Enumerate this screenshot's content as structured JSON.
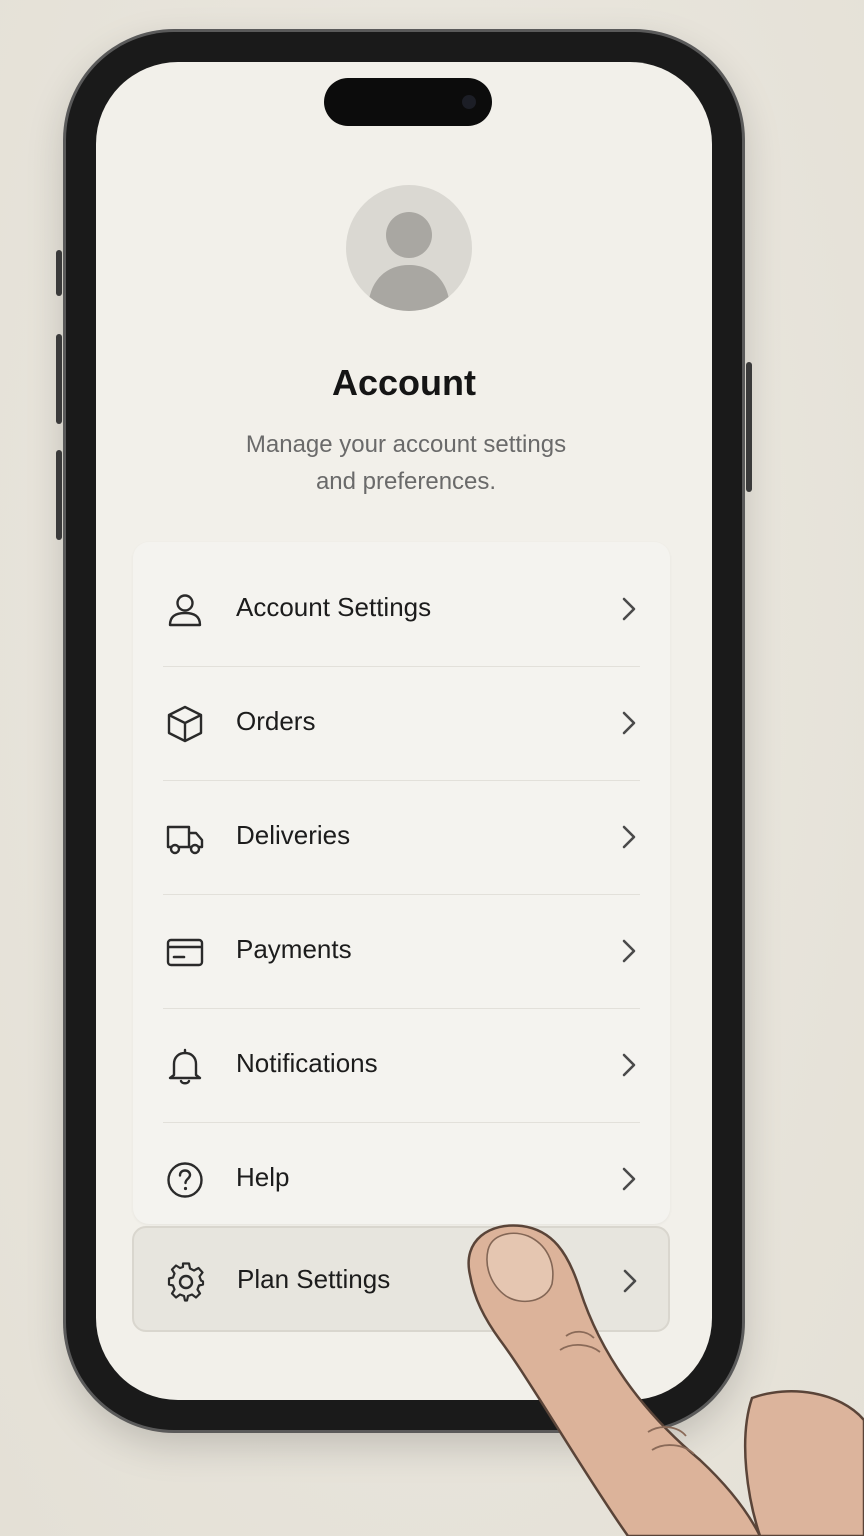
{
  "header": {
    "title": "Account",
    "subtitle_line1": "Manage your account settings",
    "subtitle_line2": "and preferences."
  },
  "menu": {
    "items": [
      {
        "label": "Account Settings",
        "icon": "user-icon"
      },
      {
        "label": "Orders",
        "icon": "box-icon"
      },
      {
        "label": "Deliveries",
        "icon": "truck-icon"
      },
      {
        "label": "Payments",
        "icon": "credit-card-icon"
      },
      {
        "label": "Notifications",
        "icon": "bell-icon"
      },
      {
        "label": "Help",
        "icon": "help-circle-icon"
      }
    ],
    "highlighted": {
      "label": "Plan Settings",
      "icon": "gear-icon"
    }
  },
  "colors": {
    "background": "#e8e5dc",
    "screen": "#f2f0ea",
    "card": "#f4f3ef",
    "highlight": "#e7e5de",
    "text": "#1c1c1c",
    "subtext": "#6a6a6a"
  }
}
